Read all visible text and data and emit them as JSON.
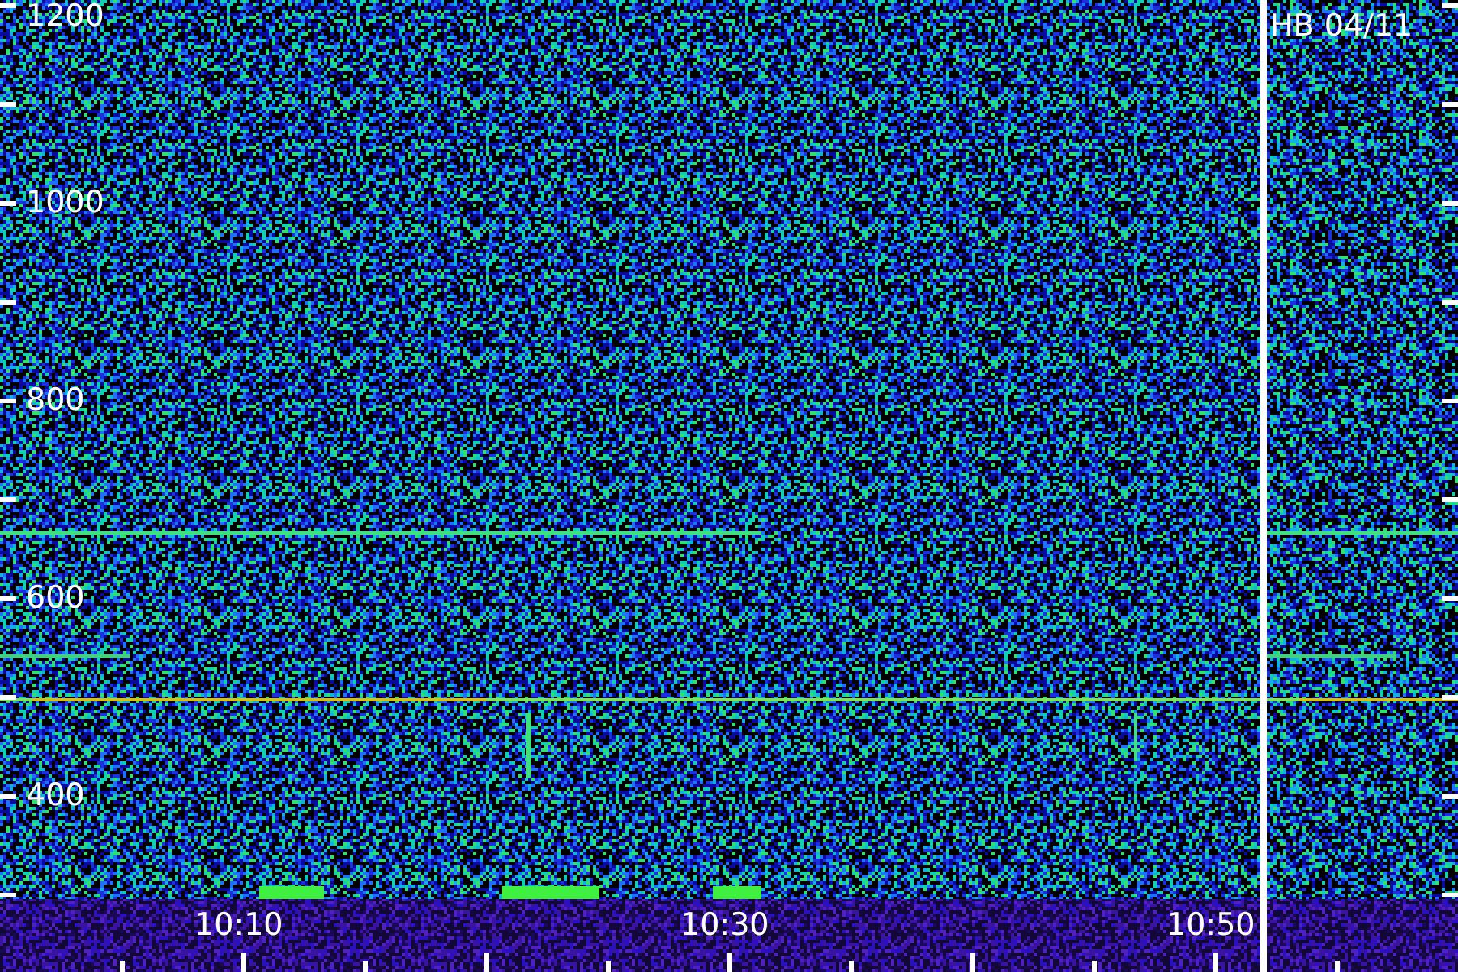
{
  "main_panel": {
    "y_axis_labels": [
      "1200",
      "1000",
      "800",
      "600",
      "400"
    ],
    "x_axis_labels": [
      "10:10",
      "10:30",
      "10:50"
    ]
  },
  "side_panel": {
    "title": "HB 04/11"
  }
}
